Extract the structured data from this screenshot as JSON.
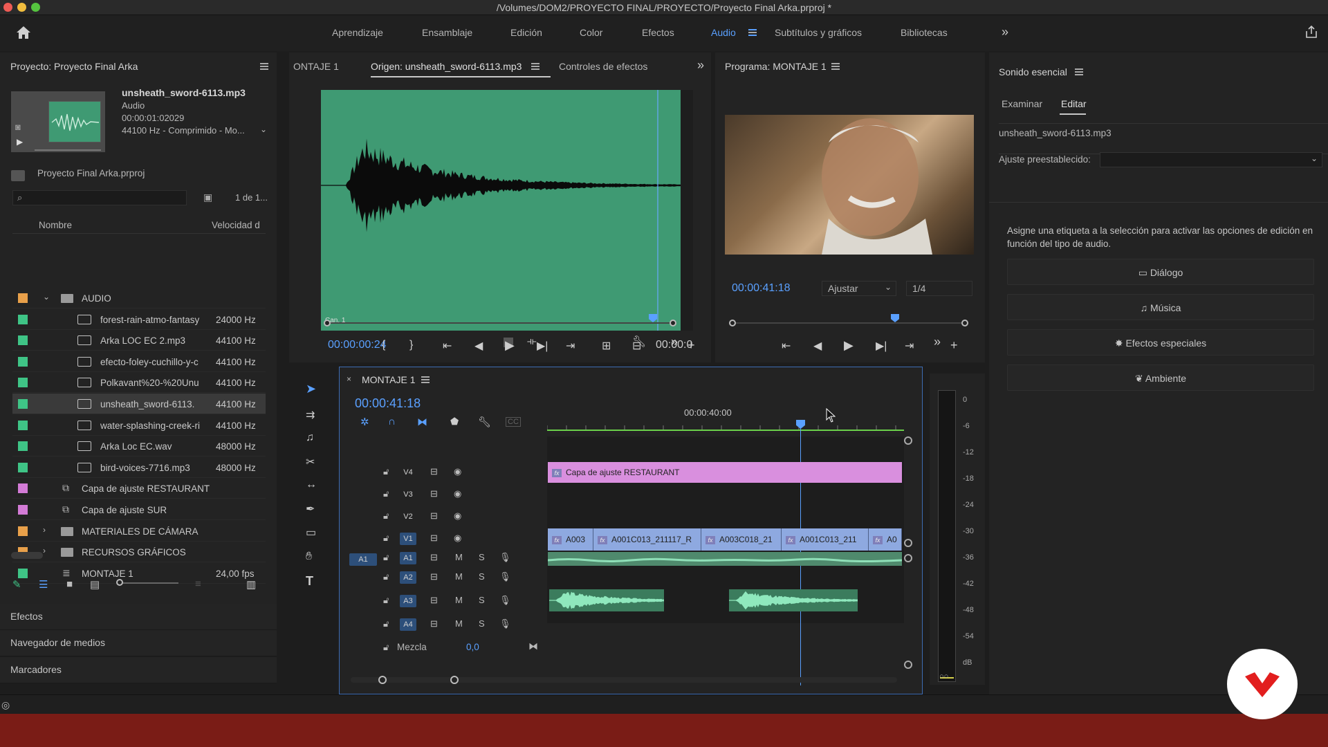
{
  "window": {
    "title": "/Volumes/DOM2/PROYECTO FINAL/PROYECTO/Proyecto Final Arka.prproj *"
  },
  "workspaces": {
    "tabs": [
      "Aprendizaje",
      "Ensamblaje",
      "Edición",
      "Color",
      "Efectos",
      "Audio",
      "Subtítulos y gráficos",
      "Bibliotecas"
    ],
    "active": "Audio"
  },
  "project": {
    "title": "Proyecto: Proyecto Final Arka",
    "preview": {
      "name": "unsheath_sword-6113.mp3",
      "type": "Audio",
      "duration": "00:00:01:02029",
      "format": "44100 Hz - Comprimido - Mo..."
    },
    "file": "Proyecto Final Arka.prproj",
    "search_placeholder": "",
    "count": "1 de 1...",
    "col_name": "Nombre",
    "col_rate": "Velocidad d",
    "rows": [
      {
        "name": "AUDIO",
        "rate": "",
        "chip": "#e8a04a"
      },
      {
        "name": "forest-rain-atmo-fantasy",
        "rate": "24000 Hz",
        "chip": "#3fc486"
      },
      {
        "name": "Arka LOC EC 2.mp3",
        "rate": "44100 Hz",
        "chip": "#3fc486"
      },
      {
        "name": "efecto-foley-cuchillo-y-c",
        "rate": "44100 Hz",
        "chip": "#3fc486"
      },
      {
        "name": "Polkavant%20-%20Unu",
        "rate": "44100 Hz",
        "chip": "#3fc486"
      },
      {
        "name": "unsheath_sword-6113.",
        "rate": "44100 Hz",
        "chip": "#3fc486"
      },
      {
        "name": "water-splashing-creek-ri",
        "rate": "44100 Hz",
        "chip": "#3fc486"
      },
      {
        "name": "Arka Loc EC.wav",
        "rate": "48000 Hz",
        "chip": "#3fc486"
      },
      {
        "name": "bird-voices-7716.mp3",
        "rate": "48000 Hz",
        "chip": "#3fc486"
      },
      {
        "name": "Capa de ajuste RESTAURANT",
        "rate": "",
        "chip": "#d37bd6"
      },
      {
        "name": "Capa de ajuste SUR",
        "rate": "",
        "chip": "#d37bd6"
      },
      {
        "name": "MATERIALES DE CÁMARA",
        "rate": "",
        "chip": "#e8a04a"
      },
      {
        "name": "RECURSOS GRÁFICOS",
        "rate": "",
        "chip": "#e8a04a"
      },
      {
        "name": "MONTAJE 1",
        "rate": "24,00 fps",
        "chip": "#3fc486"
      }
    ],
    "sections": [
      "Efectos",
      "Navegador de medios",
      "Marcadores"
    ]
  },
  "source": {
    "tabs": [
      "ONTAJE 1",
      "Origen: unsheath_sword-6113.mp3",
      "Controles de efectos"
    ],
    "channel": "Can. 1",
    "timecode": "00:00:00:24",
    "duration": "00:00:0"
  },
  "program": {
    "title": "Programa: MONTAJE 1",
    "timecode": "00:00:41:18",
    "fit": "Ajustar",
    "res": "1/4"
  },
  "timeline": {
    "name": "MONTAJE 1",
    "timecode": "00:00:41:18",
    "ruler_label": "00:00:40:00",
    "video_tracks": [
      "V4",
      "V3",
      "V2",
      "V1"
    ],
    "audio_tracks": [
      "A1",
      "A2",
      "A3",
      "A4"
    ],
    "source_patch": "A1",
    "mix_label": "Mezcla",
    "mix_value": "0,0",
    "adjust_clip": "Capa de ajuste RESTAURANT",
    "v1_clips": [
      "A003",
      "A001C013_211117_R",
      "A003C018_21",
      "A001C013_211",
      "A0"
    ]
  },
  "meter": {
    "labels": [
      "0",
      "-6",
      "-12",
      "-18",
      "-24",
      "-30",
      "-36",
      "-42",
      "-48",
      "-54",
      "dB"
    ]
  },
  "essential_sound": {
    "title": "Sonido esencial",
    "tabs": [
      "Examinar",
      "Editar"
    ],
    "active_tab": "Editar",
    "clip": "unsheath_sword-6113.mp3",
    "preset_label": "Ajuste preestablecido:",
    "hint": "Asigne una etiqueta a la selección para activar las opciones de edición en función del tipo de audio.",
    "buttons": [
      "Diálogo",
      "Música",
      "Efectos especiales",
      "Ambiente"
    ]
  },
  "colors": {
    "accent": "#5aa0ff",
    "audio_clip": "#4fbf8e",
    "adjust_clip": "#d98fde",
    "video_clip": "#8ea9e0",
    "source_bg": "#3f9a73"
  }
}
